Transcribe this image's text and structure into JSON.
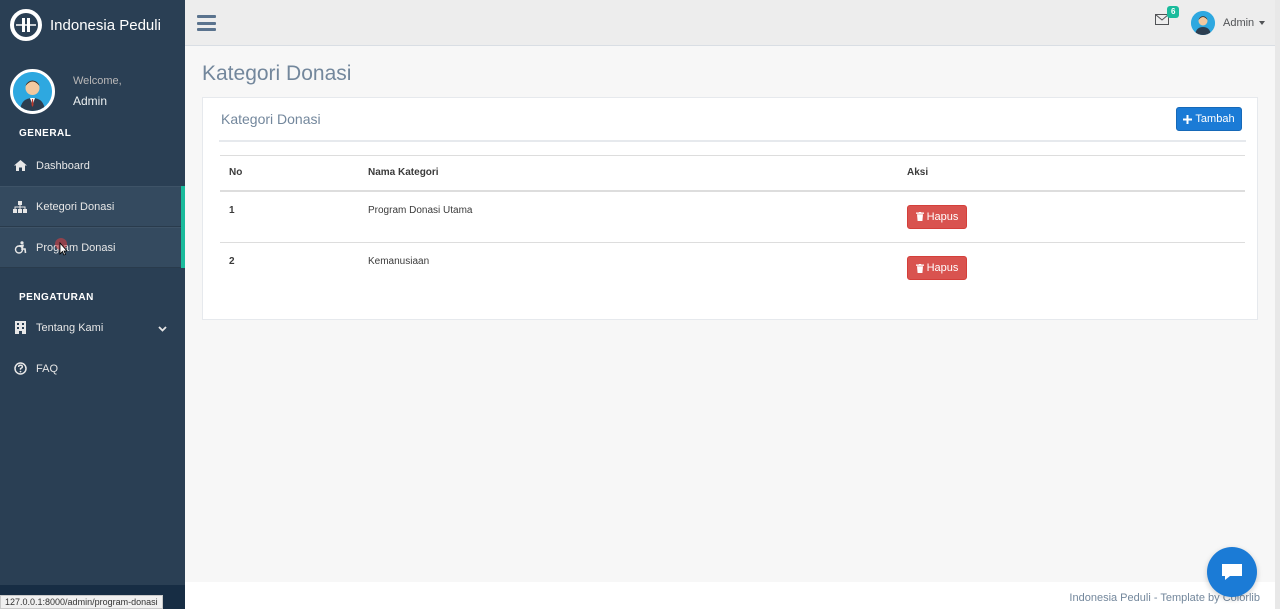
{
  "brand": {
    "title": "Indonesia Peduli"
  },
  "profile": {
    "welcome": "Welcome,",
    "name": "Admin"
  },
  "sidebar": {
    "section_general": "GENERAL",
    "section_settings": "PENGATURAN",
    "items": [
      {
        "label": "Dashboard",
        "icon": "home-icon"
      },
      {
        "label": "Ketegori Donasi",
        "icon": "sitemap-icon"
      },
      {
        "label": "Program Donasi",
        "icon": "accessibility-icon"
      },
      {
        "label": "Tentang Kami",
        "icon": "building-icon"
      },
      {
        "label": "FAQ",
        "icon": "question-circle-icon"
      }
    ]
  },
  "topbar": {
    "mail_count": "6",
    "user_name": "Admin"
  },
  "page": {
    "title": "Kategori Donasi"
  },
  "panel": {
    "title": "Kategori Donasi",
    "add_label": "Tambah",
    "columns": [
      "No",
      "Nama Kategori",
      "Aksi"
    ],
    "rows": [
      {
        "no": "1",
        "name": "Program Donasi Utama",
        "action": "Hapus"
      },
      {
        "no": "2",
        "name": "Kemanusiaan",
        "action": "Hapus"
      }
    ]
  },
  "footer": {
    "text": "Indonesia Peduli - Template by Colorlib"
  },
  "status_bar": {
    "url": "127.0.0.1:8000/admin/program-donasi"
  },
  "colors": {
    "sidebar": "#2a3f54",
    "accent": "#1abb9c",
    "primary": "#1b7bd6",
    "danger": "#d9534f"
  }
}
